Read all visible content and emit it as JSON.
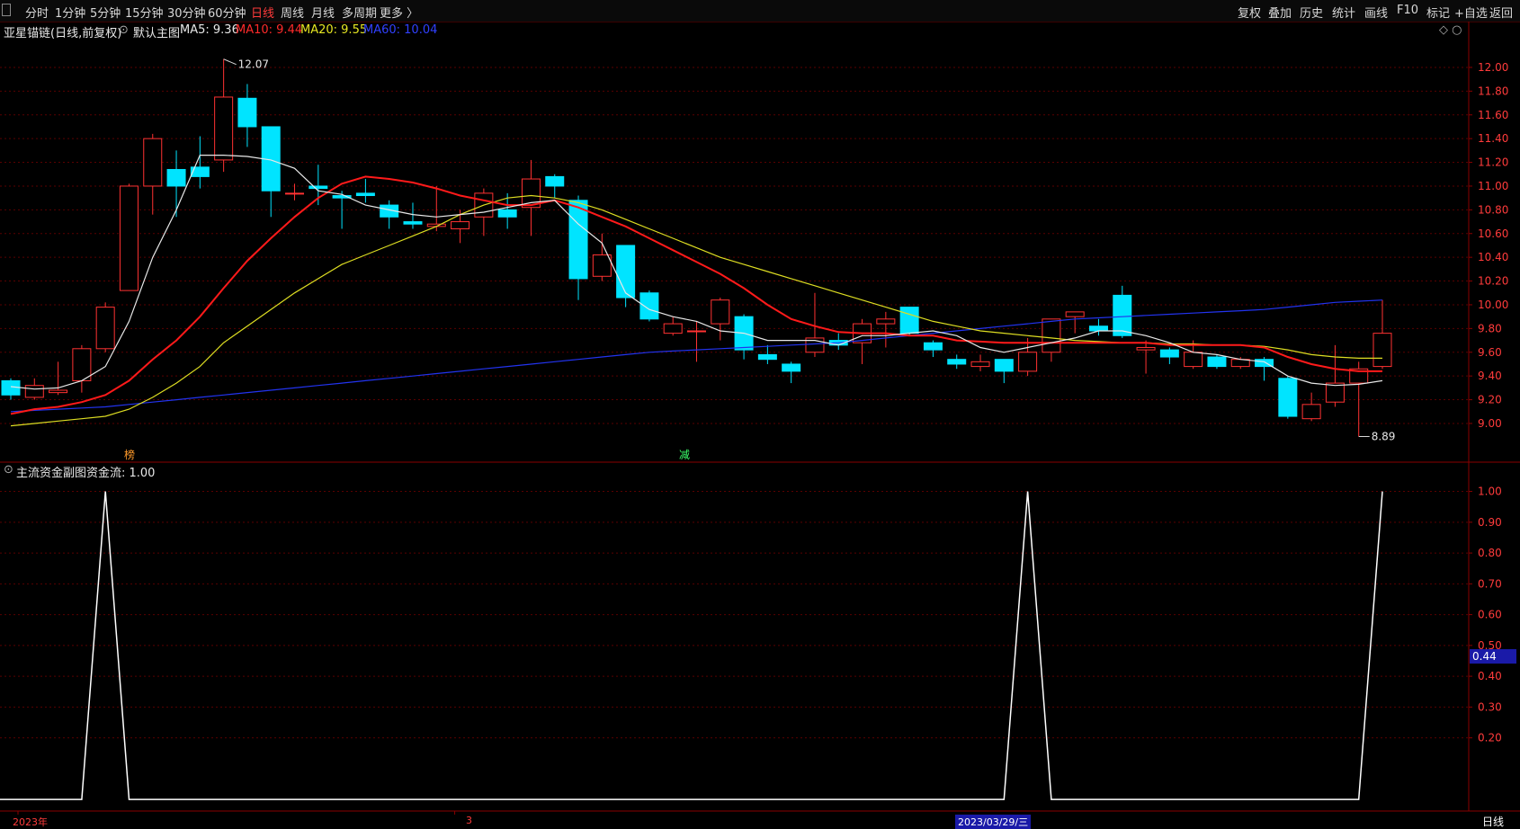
{
  "toolbar": {
    "left_items": [
      {
        "label": "分时",
        "active": false
      },
      {
        "label": "1分钟",
        "active": false
      },
      {
        "label": "5分钟",
        "active": false
      },
      {
        "label": "15分钟",
        "active": false
      },
      {
        "label": "30分钟",
        "active": false
      },
      {
        "label": "60分钟",
        "active": false
      },
      {
        "label": "日线",
        "active": true
      },
      {
        "label": "周线",
        "active": false
      },
      {
        "label": "月线",
        "active": false
      },
      {
        "label": "多周期",
        "active": false
      },
      {
        "label": "更多 〉",
        "active": false
      }
    ],
    "right_items": [
      "复权",
      "叠加",
      "历史",
      "统计",
      "画线",
      "F10",
      "标记",
      "+自选",
      "返回"
    ]
  },
  "main_chart": {
    "stock_name": "亚星锚链(日线,前复权)",
    "template": "默认主图",
    "ma5_label": "MA5: 9.36",
    "ma10_label": "MA10: 9.44",
    "ma20_label": "MA20: 9.55",
    "ma60_label": "MA60: 10.04",
    "high_label": "12.07",
    "low_label": "8.89",
    "marker_left": "榜",
    "marker_mid": "减",
    "ctrl_icons": "◇ ○"
  },
  "sub_chart": {
    "title": "主流资金副图",
    "value_label": "资金流: 1.00",
    "cursor_value": "0.44"
  },
  "bottom": {
    "year_label": "2023年",
    "month_label": "3",
    "selected_date": "2023/03/29/三",
    "period": "日线"
  },
  "colors": {
    "up": "#ff3232",
    "down": "#00e4ff",
    "ma5": "#e8e8e8",
    "ma10": "#ff1a1a",
    "ma20": "#dddd22",
    "ma60": "#2233ee",
    "flow": "#ffffff",
    "grid": "#5a0000"
  },
  "chart_data": [
    {
      "type": "candlestick",
      "y_ticks": [
        "12.00",
        "11.80",
        "11.60",
        "11.40",
        "11.20",
        "11.00",
        "10.80",
        "10.60",
        "10.40",
        "10.20",
        "10.00",
        "9.80",
        "9.60",
        "9.40",
        "9.20",
        "9.00"
      ],
      "ylim": [
        8.78,
        12.28
      ],
      "candles": [
        {
          "o": 9.36,
          "c": 9.24,
          "h": 9.38,
          "l": 9.2
        },
        {
          "o": 9.22,
          "c": 9.32,
          "h": 9.38,
          "l": 9.2
        },
        {
          "o": 9.26,
          "c": 9.28,
          "h": 9.52,
          "l": 9.24
        },
        {
          "o": 9.36,
          "c": 9.63,
          "h": 9.66,
          "l": 9.26
        },
        {
          "o": 9.63,
          "c": 9.98,
          "h": 10.02,
          "l": 9.6
        },
        {
          "o": 10.12,
          "c": 11.0,
          "h": 11.02,
          "l": 10.12
        },
        {
          "o": 11.0,
          "c": 11.4,
          "h": 11.44,
          "l": 10.76
        },
        {
          "o": 11.14,
          "c": 11.0,
          "h": 11.3,
          "l": 10.74
        },
        {
          "o": 11.16,
          "c": 11.08,
          "h": 11.42,
          "l": 10.98
        },
        {
          "o": 11.22,
          "c": 11.75,
          "h": 12.07,
          "l": 11.12
        },
        {
          "o": 11.74,
          "c": 11.5,
          "h": 11.86,
          "l": 11.33
        },
        {
          "o": 11.5,
          "c": 10.96,
          "h": 11.5,
          "l": 10.74
        },
        {
          "o": 10.94,
          "c": 10.94,
          "h": 11.02,
          "l": 10.88
        },
        {
          "o": 11.0,
          "c": 10.98,
          "h": 11.18,
          "l": 10.84
        },
        {
          "o": 10.92,
          "c": 10.9,
          "h": 10.96,
          "l": 10.64
        },
        {
          "o": 10.94,
          "c": 10.92,
          "h": 11.06,
          "l": 10.86
        },
        {
          "o": 10.84,
          "c": 10.74,
          "h": 10.88,
          "l": 10.64
        },
        {
          "o": 10.7,
          "c": 10.68,
          "h": 10.86,
          "l": 10.64
        },
        {
          "o": 10.66,
          "c": 10.68,
          "h": 11.0,
          "l": 10.62
        },
        {
          "o": 10.64,
          "c": 10.7,
          "h": 10.8,
          "l": 10.52
        },
        {
          "o": 10.74,
          "c": 10.94,
          "h": 10.98,
          "l": 10.58
        },
        {
          "o": 10.8,
          "c": 10.74,
          "h": 10.94,
          "l": 10.64
        },
        {
          "o": 10.82,
          "c": 11.06,
          "h": 11.22,
          "l": 10.58
        },
        {
          "o": 11.08,
          "c": 11.0,
          "h": 11.1,
          "l": 10.9
        },
        {
          "o": 10.88,
          "c": 10.22,
          "h": 10.92,
          "l": 10.04
        },
        {
          "o": 10.24,
          "c": 10.42,
          "h": 10.6,
          "l": 10.2
        },
        {
          "o": 10.5,
          "c": 10.06,
          "h": 10.5,
          "l": 9.98
        },
        {
          "o": 10.1,
          "c": 9.88,
          "h": 10.12,
          "l": 9.86
        },
        {
          "o": 9.76,
          "c": 9.84,
          "h": 9.9,
          "l": 9.74
        },
        {
          "o": 9.78,
          "c": 9.78,
          "h": 9.86,
          "l": 9.52
        },
        {
          "o": 9.84,
          "c": 10.04,
          "h": 10.06,
          "l": 9.7
        },
        {
          "o": 9.9,
          "c": 9.62,
          "h": 9.92,
          "l": 9.54
        },
        {
          "o": 9.58,
          "c": 9.54,
          "h": 9.66,
          "l": 9.5
        },
        {
          "o": 9.5,
          "c": 9.44,
          "h": 9.52,
          "l": 9.34
        },
        {
          "o": 9.6,
          "c": 9.72,
          "h": 10.1,
          "l": 9.56
        },
        {
          "o": 9.7,
          "c": 9.66,
          "h": 9.76,
          "l": 9.62
        },
        {
          "o": 9.68,
          "c": 9.84,
          "h": 9.88,
          "l": 9.5
        },
        {
          "o": 9.84,
          "c": 9.88,
          "h": 9.94,
          "l": 9.64
        },
        {
          "o": 9.98,
          "c": 9.76,
          "h": 9.98,
          "l": 9.74
        },
        {
          "o": 9.68,
          "c": 9.62,
          "h": 9.7,
          "l": 9.56
        },
        {
          "o": 9.54,
          "c": 9.5,
          "h": 9.58,
          "l": 9.46
        },
        {
          "o": 9.48,
          "c": 9.52,
          "h": 9.58,
          "l": 9.44
        },
        {
          "o": 9.54,
          "c": 9.44,
          "h": 9.54,
          "l": 9.34
        },
        {
          "o": 9.44,
          "c": 9.6,
          "h": 9.72,
          "l": 9.4
        },
        {
          "o": 9.6,
          "c": 9.88,
          "h": 9.88,
          "l": 9.52
        },
        {
          "o": 9.9,
          "c": 9.94,
          "h": 9.94,
          "l": 9.76
        },
        {
          "o": 9.82,
          "c": 9.78,
          "h": 9.88,
          "l": 9.74
        },
        {
          "o": 10.08,
          "c": 9.74,
          "h": 10.16,
          "l": 9.72
        },
        {
          "o": 9.62,
          "c": 9.64,
          "h": 9.7,
          "l": 9.42
        },
        {
          "o": 9.62,
          "c": 9.56,
          "h": 9.64,
          "l": 9.5
        },
        {
          "o": 9.48,
          "c": 9.6,
          "h": 9.7,
          "l": 9.46
        },
        {
          "o": 9.56,
          "c": 9.48,
          "h": 9.58,
          "l": 9.46
        },
        {
          "o": 9.48,
          "c": 9.54,
          "h": 9.56,
          "l": 9.46
        },
        {
          "o": 9.54,
          "c": 9.48,
          "h": 9.56,
          "l": 9.36
        },
        {
          "o": 9.38,
          "c": 9.06,
          "h": 9.4,
          "l": 9.04
        },
        {
          "o": 9.04,
          "c": 9.16,
          "h": 9.26,
          "l": 9.02
        },
        {
          "o": 9.18,
          "c": 9.34,
          "h": 9.66,
          "l": 9.14
        },
        {
          "o": 9.34,
          "c": 9.46,
          "h": 9.52,
          "l": 8.89
        },
        {
          "o": 9.48,
          "c": 9.76,
          "h": 10.04,
          "l": 9.46
        }
      ],
      "ma5": [
        9.31,
        9.29,
        9.3,
        9.36,
        9.48,
        9.86,
        10.4,
        10.8,
        11.26,
        11.26,
        11.25,
        11.22,
        11.15,
        10.96,
        10.93,
        10.84,
        10.8,
        10.76,
        10.74,
        10.76,
        10.78,
        10.82,
        10.86,
        10.88,
        10.68,
        10.52,
        10.1,
        9.96,
        9.9,
        9.86,
        9.78,
        9.76,
        9.7,
        9.7,
        9.7,
        9.66,
        9.74,
        9.74,
        9.76,
        9.78,
        9.74,
        9.64,
        9.6,
        9.64,
        9.68,
        9.72,
        9.78,
        9.78,
        9.74,
        9.68,
        9.6,
        9.58,
        9.54,
        9.52,
        9.4,
        9.34,
        9.32,
        9.33,
        9.36
      ],
      "ma10": [
        9.08,
        9.12,
        9.14,
        9.18,
        9.24,
        9.36,
        9.54,
        9.7,
        9.9,
        10.14,
        10.37,
        10.56,
        10.74,
        10.9,
        11.02,
        11.08,
        11.06,
        11.03,
        10.98,
        10.92,
        10.88,
        10.84,
        10.84,
        10.88,
        10.82,
        10.74,
        10.66,
        10.56,
        10.46,
        10.36,
        10.26,
        10.14,
        10.0,
        9.88,
        9.82,
        9.77,
        9.76,
        9.76,
        9.74,
        9.74,
        9.7,
        9.69,
        9.68,
        9.68,
        9.68,
        9.68,
        9.68,
        9.68,
        9.68,
        9.66,
        9.66,
        9.66,
        9.66,
        9.64,
        9.56,
        9.5,
        9.46,
        9.44,
        9.44
      ],
      "ma20": [
        8.98,
        9.0,
        9.02,
        9.04,
        9.06,
        9.12,
        9.22,
        9.34,
        9.48,
        9.68,
        9.82,
        9.96,
        10.1,
        10.22,
        10.34,
        10.42,
        10.5,
        10.58,
        10.66,
        10.76,
        10.84,
        10.9,
        10.92,
        10.9,
        10.86,
        10.8,
        10.72,
        10.64,
        10.56,
        10.48,
        10.4,
        10.34,
        10.28,
        10.22,
        10.16,
        10.1,
        10.04,
        9.98,
        9.92,
        9.86,
        9.82,
        9.78,
        9.76,
        9.74,
        9.72,
        9.7,
        9.69,
        9.68,
        9.68,
        9.67,
        9.67,
        9.66,
        9.66,
        9.65,
        9.62,
        9.58,
        9.56,
        9.55,
        9.55
      ],
      "ma60": [
        9.1,
        9.11,
        9.12,
        9.13,
        9.14,
        9.16,
        9.18,
        9.2,
        9.22,
        9.24,
        9.26,
        9.28,
        9.3,
        9.32,
        9.34,
        9.36,
        9.38,
        9.4,
        9.42,
        9.44,
        9.46,
        9.48,
        9.5,
        9.52,
        9.54,
        9.56,
        9.58,
        9.6,
        9.61,
        9.62,
        9.63,
        9.64,
        9.65,
        9.66,
        9.67,
        9.68,
        9.7,
        9.72,
        9.74,
        9.76,
        9.78,
        9.8,
        9.82,
        9.84,
        9.86,
        9.88,
        9.89,
        9.9,
        9.91,
        9.92,
        9.93,
        9.94,
        9.95,
        9.96,
        9.98,
        10.0,
        10.02,
        10.03,
        10.04
      ]
    },
    {
      "type": "line",
      "y_ticks": [
        "1.00",
        "0.90",
        "0.80",
        "0.70",
        "0.60",
        "0.50",
        "0.40",
        "0.30",
        "0.20"
      ],
      "ylim": [
        -0.02,
        1.06
      ],
      "values": [
        0,
        0,
        0,
        0,
        1,
        0,
        0,
        0,
        0,
        0,
        0,
        0,
        0,
        0,
        0,
        0,
        0,
        0,
        0,
        0,
        0,
        0,
        0,
        0,
        0,
        0,
        0,
        0,
        0,
        0,
        0,
        0,
        0,
        0,
        0,
        0,
        0,
        0,
        0,
        0,
        0,
        0,
        0,
        1,
        0,
        0,
        0,
        0,
        0,
        0,
        0,
        0,
        0,
        0,
        0,
        0,
        0,
        0,
        1
      ]
    }
  ]
}
